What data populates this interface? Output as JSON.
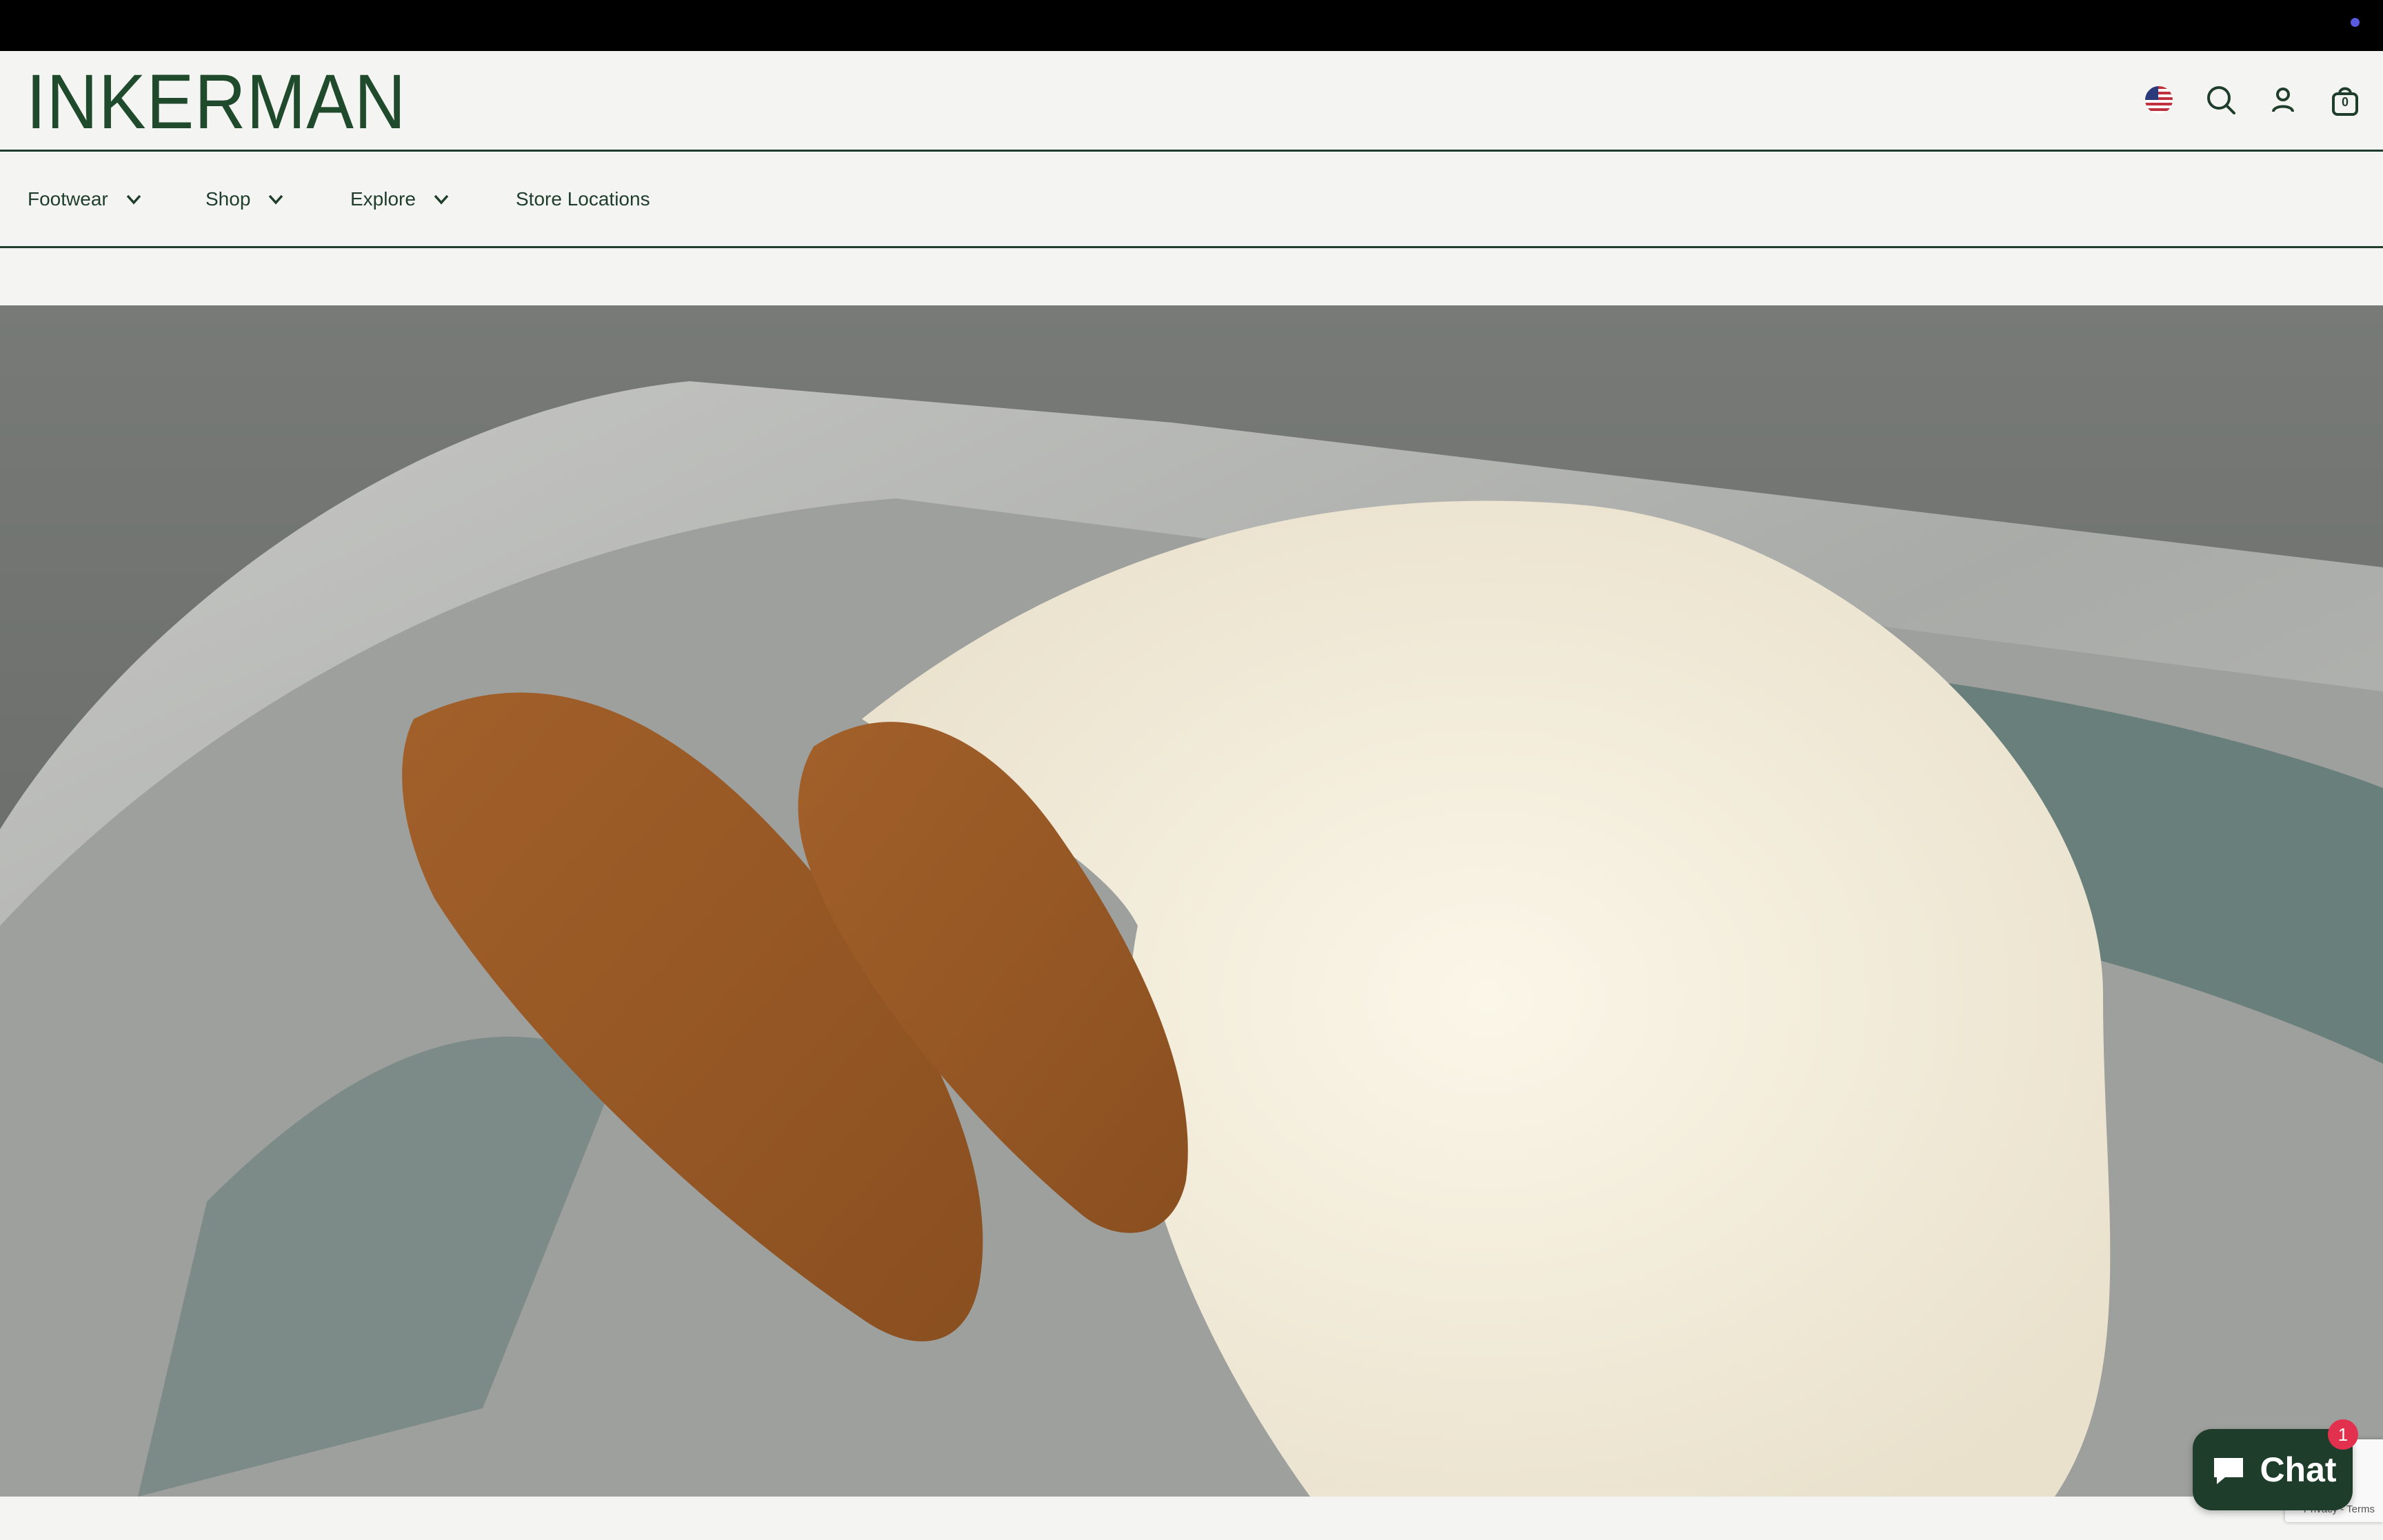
{
  "header": {
    "logo": "INKERMAN",
    "icons": [
      "us-flag-icon",
      "search-icon",
      "account-icon",
      "bag-icon"
    ],
    "cart_count": "0"
  },
  "nav": {
    "items": [
      {
        "label": "Footwear",
        "has_dropdown": true
      },
      {
        "label": "Shop",
        "has_dropdown": true
      },
      {
        "label": "Explore",
        "has_dropdown": true
      },
      {
        "label": "Store Locations",
        "has_dropdown": false
      }
    ]
  },
  "hero": {
    "subject": "brown-suede-driving-loafers-and-cream-knit-sweater-in-boat"
  },
  "chat": {
    "label": "Chat",
    "badge": "1"
  },
  "recaptcha": {
    "text": "Privacy - Terms"
  },
  "colors": {
    "brand_green": "#1f3d2b",
    "announce_bar": "#000000",
    "background": "#f4f4f2",
    "chat_badge": "#e2304f"
  }
}
